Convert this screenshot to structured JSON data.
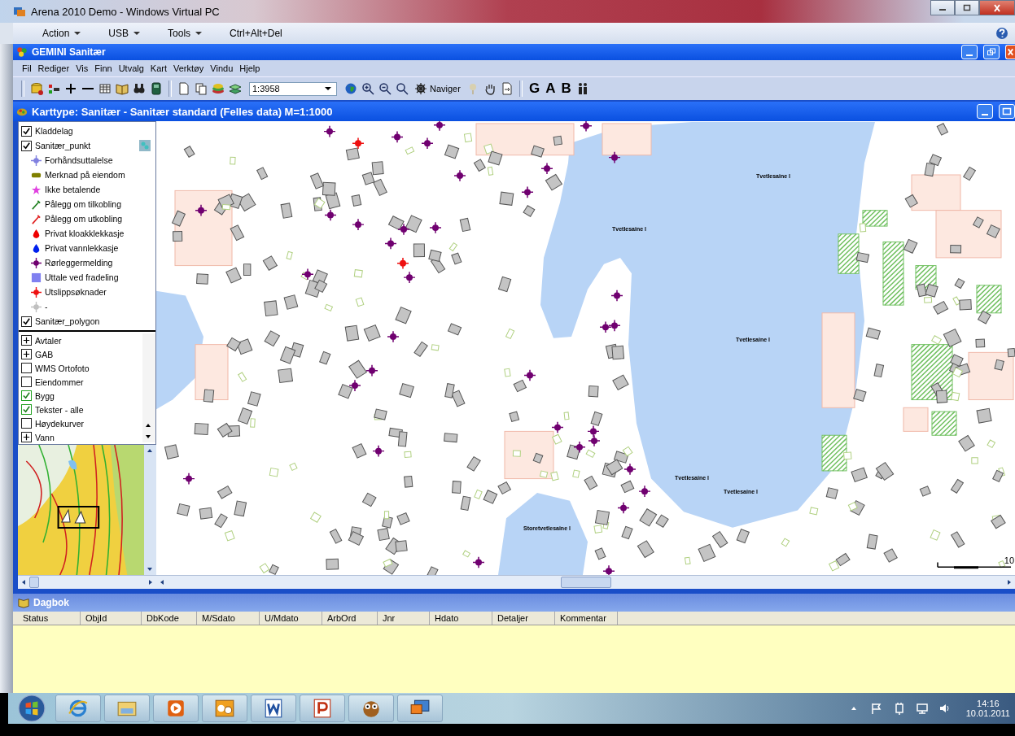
{
  "window": {
    "title": "Arena 2010 Demo - Windows Virtual PC"
  },
  "vpc_menu": [
    {
      "label": "Action",
      "dropdown": true
    },
    {
      "label": "USB",
      "dropdown": true
    },
    {
      "label": "Tools",
      "dropdown": true
    },
    {
      "label": "Ctrl+Alt+Del",
      "dropdown": false
    }
  ],
  "app": {
    "title": "GEMINI Sanitær"
  },
  "menu": [
    "Fil",
    "Rediger",
    "Vis",
    "Finn",
    "Utvalg",
    "Kart",
    "Verktøy",
    "Vindu",
    "Hjelp"
  ],
  "toolbar": {
    "scale": "1:3958",
    "navigate": "Naviger",
    "letters": [
      "G",
      "A",
      "B"
    ]
  },
  "map_window": {
    "title": "Karttype: Sanitær - Sanitær standard (Felles data) M=1:1000"
  },
  "layers": [
    {
      "label": "Kladdelag",
      "checked": true
    },
    {
      "label": "Sanitær_punkt",
      "checked": true,
      "children": [
        {
          "label": "Forhåndsuttalelse",
          "kind": "cross",
          "color": "#8080e0"
        },
        {
          "label": "Merknad på eiendom",
          "kind": "bar",
          "color": "#808000"
        },
        {
          "label": "Ikke betalende",
          "kind": "star",
          "color": "#e040e0"
        },
        {
          "label": "Pålegg om tilkobling",
          "kind": "pin",
          "color": "#208020"
        },
        {
          "label": "Pålegg om utkobling",
          "kind": "pin",
          "color": "#e02020"
        },
        {
          "label": "Privat kloakklekkasje",
          "kind": "drop",
          "color": "#ee0000"
        },
        {
          "label": "Privat vannlekkasje",
          "kind": "drop",
          "color": "#0020ee"
        },
        {
          "label": "Rørleggermelding",
          "kind": "cross",
          "color": "#700070"
        },
        {
          "label": "Uttale ved fradeling",
          "kind": "square",
          "color": "#8080f0"
        },
        {
          "label": "Utslippsøknader",
          "kind": "cross",
          "color": "#ee1010"
        },
        {
          "label": "-",
          "kind": "cross",
          "color": "#c0c0c0"
        }
      ]
    },
    {
      "label": "Sanitær_polygon",
      "checked": true
    }
  ],
  "more_layers": [
    {
      "label": "Avtaler",
      "kind": "group",
      "expanded": false
    },
    {
      "label": "GAB",
      "kind": "group",
      "expanded": false
    },
    {
      "label": "WMS Ortofoto",
      "kind": "check",
      "checked": false
    },
    {
      "label": "Eiendommer",
      "kind": "check",
      "checked": false
    },
    {
      "label": "Bygg",
      "kind": "check",
      "checked": true
    },
    {
      "label": "Tekster - alle",
      "kind": "check",
      "checked": true
    },
    {
      "label": "Høydekurver",
      "kind": "check",
      "checked": false
    },
    {
      "label": "Vann",
      "kind": "group",
      "expanded": false
    }
  ],
  "map": {
    "lake_labels": [
      "Tvetlesaine l",
      "Tvetlesaine l",
      "Tvetlesaine l",
      "Tvetlesaine l",
      "Tvetlesaine l",
      "Storetvetlesaine l"
    ],
    "scale_label": "10"
  },
  "log": {
    "title": "Dagbok",
    "columns": [
      "Status",
      "ObjId",
      "DbKode",
      "M/Sdato",
      "U/Mdato",
      "ArbOrd",
      "Jnr",
      "Hdato",
      "Detaljer",
      "Kommentar"
    ]
  },
  "taskbar": {
    "time": "14:16",
    "date": "10.01.2011"
  }
}
